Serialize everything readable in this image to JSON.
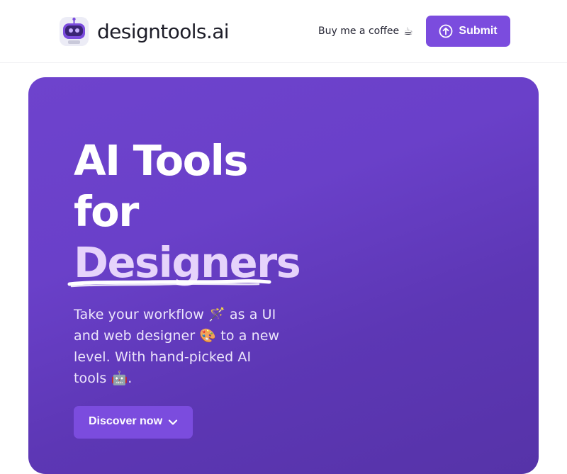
{
  "header": {
    "logo_text": "designtools.ai",
    "logo_icon": "robot-icon",
    "coffee_label": "Buy me a coffee",
    "coffee_emoji": "☕",
    "submit_label": "Submit",
    "submit_icon": "upload-circle-icon"
  },
  "hero": {
    "title_line1": "AI Tools",
    "title_line2": "for",
    "title_accent": "Designers",
    "description": "Take your workflow 🪄 as a UI and web designer 🎨 to a new level. With hand-picked AI tools 🤖.",
    "cta_label": "Discover now",
    "cta_icon": "chevron-down-icon"
  },
  "colors": {
    "accent": "#7b4cde",
    "hero_bg": "#6a40c9",
    "title_accent": "#e6d3fb"
  }
}
